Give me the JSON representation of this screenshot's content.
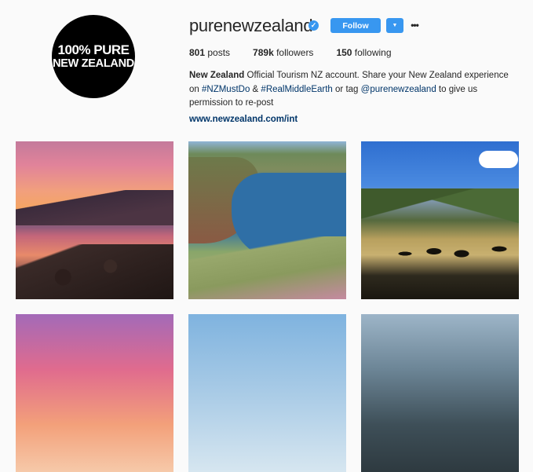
{
  "profile": {
    "avatar_line1": "100% PURE",
    "avatar_line2": "NEW ZEALAND",
    "username": "purenewzealand",
    "verified_icon": "verified-badge-icon",
    "follow_label": "Follow",
    "dropdown_icon": "caret-down-icon",
    "more_icon": "more-options-icon",
    "more_glyph": "•••"
  },
  "stats": {
    "posts_count": "801",
    "posts_label": " posts",
    "followers_count": "789k",
    "followers_label": " followers",
    "following_count": "150",
    "following_label": " following"
  },
  "bio": {
    "name": "New Zealand",
    "text1": " Official Tourism NZ account. Share your New Zealand experience on ",
    "tag1": "#NZMustDo",
    "text2": " & ",
    "tag2": "#RealMiddleEarth",
    "text3": " or tag ",
    "tag3": "@purenewzealand",
    "text4": " to give us permission to re-post",
    "url": "www.newzealand.com/int"
  },
  "posts": [
    {
      "subject": "sunset over lake with rocks"
    },
    {
      "subject": "coastal cliffs and blue bay"
    },
    {
      "subject": "hikers silhouetted in valley"
    },
    {
      "subject": "pink sunset sky"
    },
    {
      "subject": "blue sky and clouds"
    },
    {
      "subject": "mountain peaks"
    }
  ],
  "colors": {
    "accent": "#3897f0",
    "link": "#003569",
    "background": "#fafafa"
  }
}
